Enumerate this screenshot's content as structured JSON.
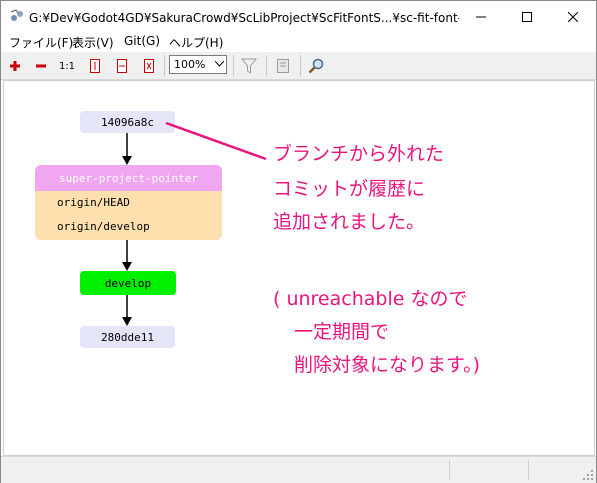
{
  "window": {
    "title": "G:¥Dev¥Godot4GD¥SakuraCrowd¥ScLibProject¥ScFitFontS...¥sc-fit-font-size - リ..."
  },
  "menu": {
    "items": [
      {
        "label": "ファイル(F)"
      },
      {
        "label": "表示(V)"
      },
      {
        "label": "Git(G)"
      },
      {
        "label": "ヘルプ(H)"
      }
    ]
  },
  "toolbar": {
    "actual_size_label": "1:1",
    "zoom_value": "100%"
  },
  "graph": {
    "top_commit": "14096a8c",
    "group_header": "super-project-pointer",
    "group_refs": [
      "origin/HEAD",
      "origin/develop"
    ],
    "branch": "develop",
    "bottom_commit": "280dde11"
  },
  "annotation": {
    "lines": [
      "ブランチから外れた",
      "コミットが履歴に",
      "追加されました。",
      "( unreachable なので",
      "一定期間で",
      "削除対象になります。)"
    ],
    "color": "#e8157f"
  },
  "colors": {
    "commit_node": "#e4e6f8",
    "group_header": "#f0a6f0",
    "group_body": "#fde0ae",
    "branch_node": "#00f000"
  }
}
